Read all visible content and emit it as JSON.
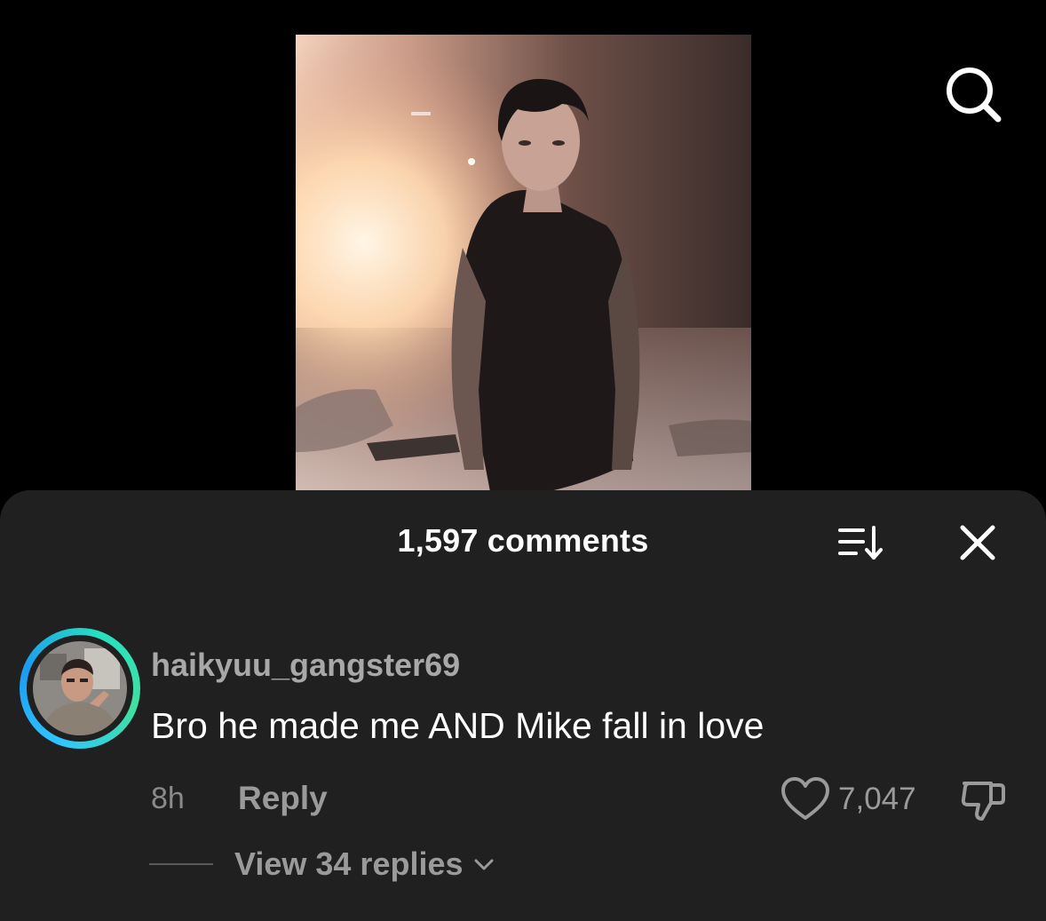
{
  "header": {
    "search_icon": "search-icon"
  },
  "comments_panel": {
    "title": "1,597 comments",
    "sort_icon": "sort-icon",
    "close_icon": "close-icon"
  },
  "comment": {
    "username": "haikyuu_gangster69",
    "text": "Bro he made me AND Mike fall in love",
    "time": "8h",
    "reply_label": "Reply",
    "like_count": "7,047",
    "like_icon": "heart-icon",
    "dislike_icon": "thumbs-down-icon",
    "view_replies_label": "View 34 replies",
    "avatar_ring_colors": [
      "#2fc6ff",
      "#27e0c0"
    ]
  },
  "colors": {
    "background": "#000000",
    "sheet": "#202020",
    "primary_text": "#ffffff",
    "secondary_text": "#9a9a9a"
  }
}
